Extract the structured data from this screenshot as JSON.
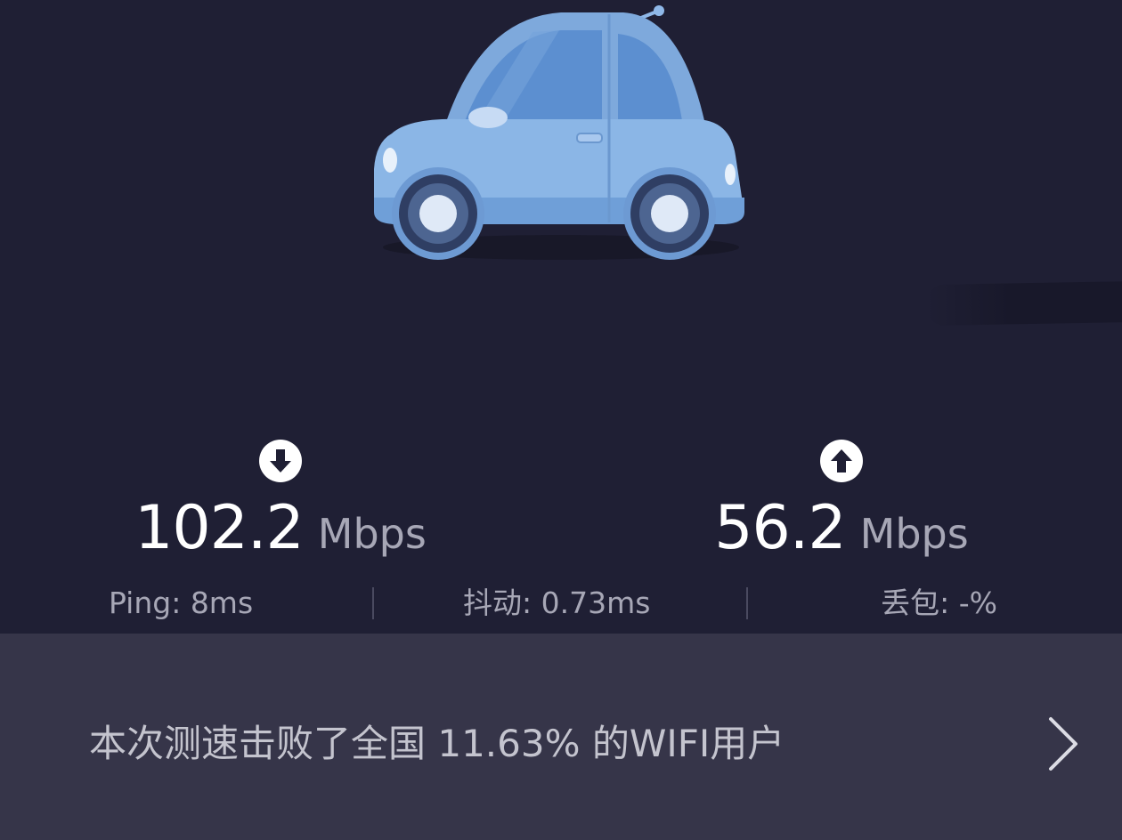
{
  "download": {
    "icon": "arrow-down-circle-icon",
    "value": "102.2",
    "unit": "Mbps"
  },
  "upload": {
    "icon": "arrow-up-circle-icon",
    "value": "56.2",
    "unit": "Mbps"
  },
  "stats": {
    "ping": "Ping:  8ms",
    "jitter": "抖动:  0.73ms",
    "loss": "丢包:  -%"
  },
  "result": {
    "text": "本次测速击败了全国 11.63% 的WIFI用户",
    "icon": "chevron-right-icon"
  },
  "colors": {
    "background": "#1f1f34",
    "panel": "#363549",
    "car_body": "#8bb6e6",
    "primary_text": "#ffffff",
    "secondary_text": "#a7a7b6"
  }
}
